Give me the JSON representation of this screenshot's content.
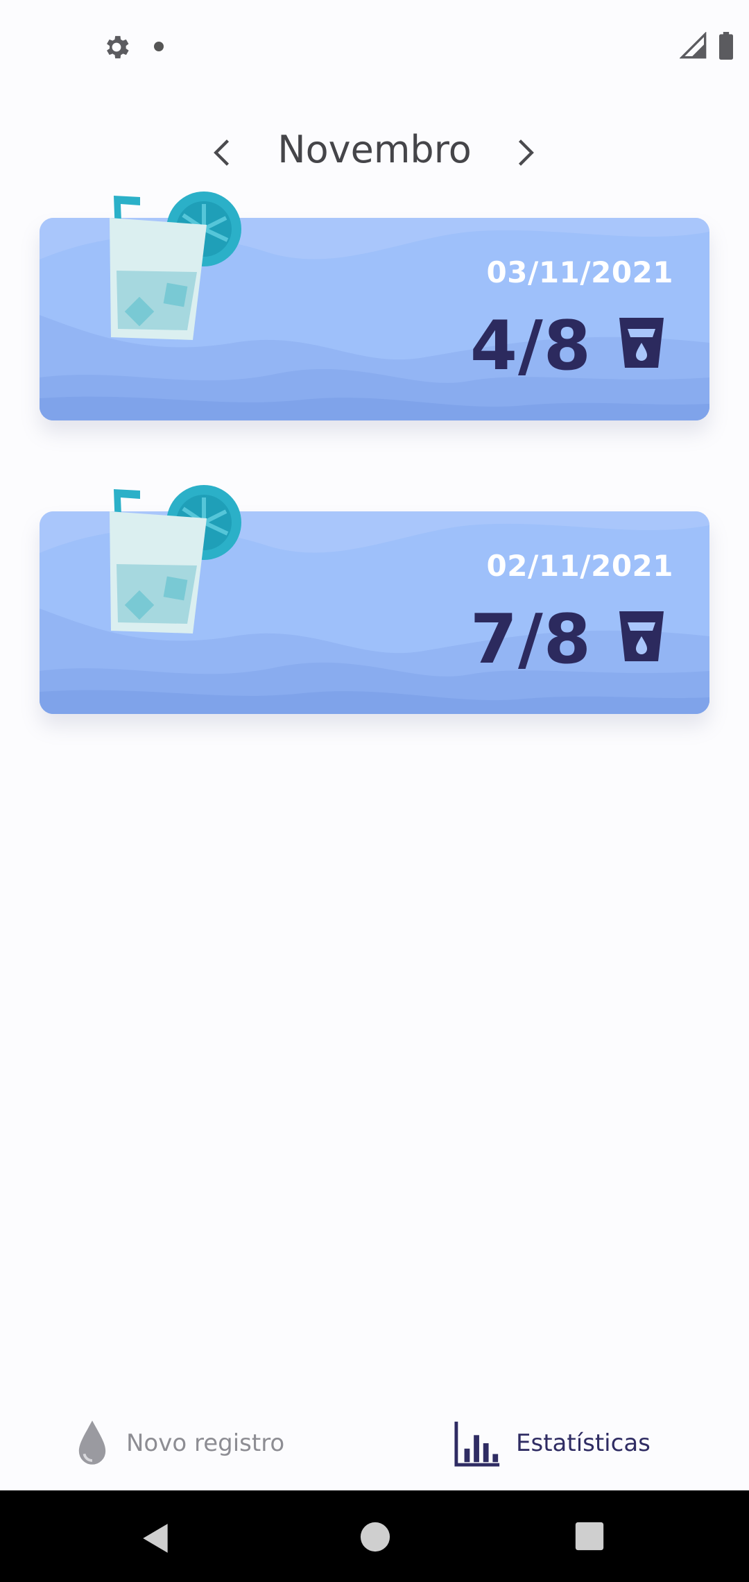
{
  "month_header": {
    "title": "Novembro",
    "prev_icon": "chevron-left-icon",
    "next_icon": "chevron-right-icon"
  },
  "records": [
    {
      "date": "03/11/2021",
      "count": "4/8"
    },
    {
      "date": "02/11/2021",
      "count": "7/8"
    }
  ],
  "bottom_nav": {
    "new_record_label": "Novo registro",
    "stats_label": "Estatísticas"
  },
  "colors": {
    "card_bg": "#a9c6fb",
    "accent_dark": "#2c2a5e",
    "accent_teal": "#2bb0c8"
  }
}
